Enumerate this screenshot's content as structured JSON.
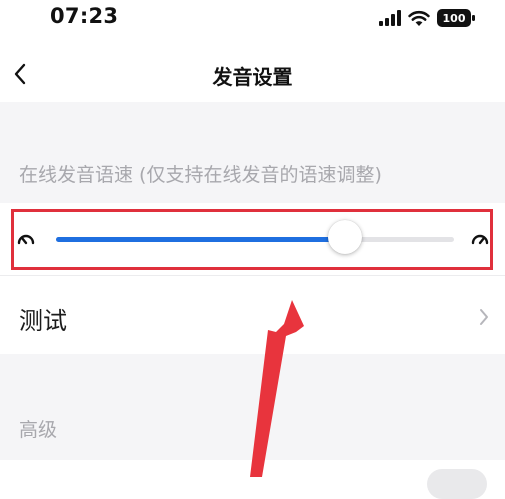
{
  "status_bar": {
    "time": "07:23",
    "battery_label": "100",
    "icons": [
      "signal-icon",
      "wifi-icon",
      "battery-icon"
    ]
  },
  "nav": {
    "back_icon": "chevron-left-icon",
    "title": "发音设置"
  },
  "speech_speed": {
    "section_label": "在线发音语速 (仅支持在线发音的语速调整)",
    "slow_icon": "speedometer-slow-icon",
    "fast_icon": "speedometer-fast-icon",
    "value_fraction": 0.725
  },
  "test_row": {
    "label": "测试",
    "chevron_icon": "chevron-right-icon"
  },
  "advanced": {
    "section_label": "高级",
    "toggle_on": false
  },
  "colors": {
    "accent": "#1f6fe0",
    "highlight": "#e0303c",
    "annotation_arrow": "#e8343d"
  }
}
